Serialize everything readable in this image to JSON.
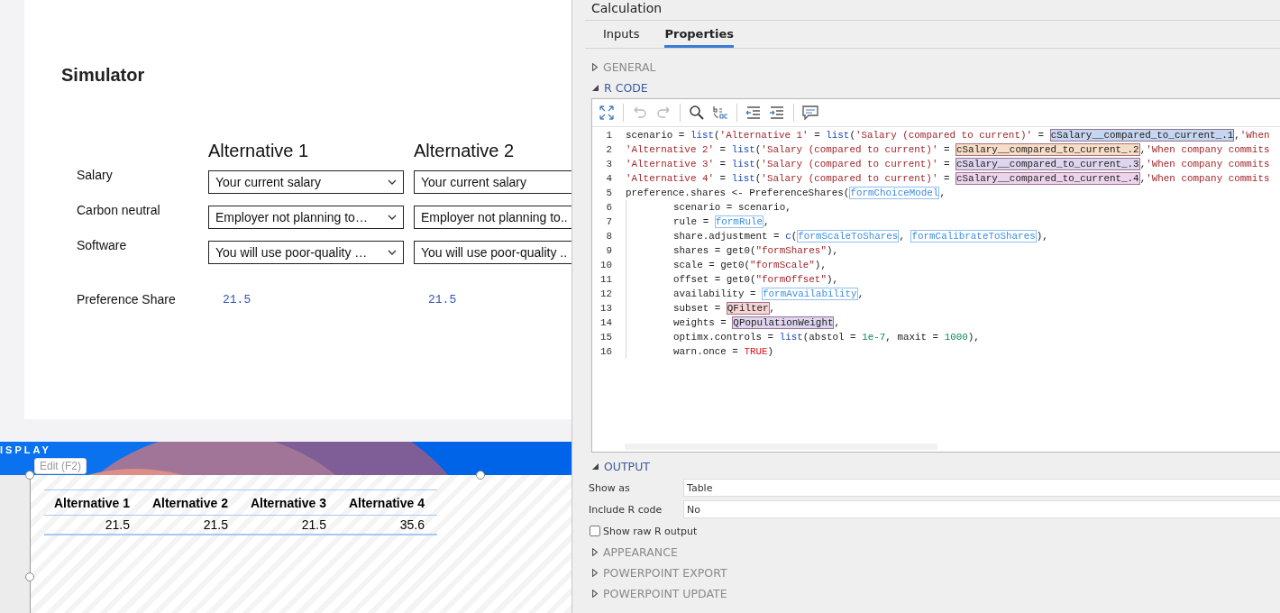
{
  "simulator": {
    "title": "Simulator",
    "alternatives": [
      {
        "name": "Alternative 1",
        "clipped": false,
        "share": "21.5"
      },
      {
        "name": "Alternative 2",
        "clipped": true,
        "share": "21.5"
      }
    ],
    "attributes": [
      {
        "label": "Salary",
        "values": [
          "Your current salary",
          "Your current salary"
        ]
      },
      {
        "label": "Carbon neutral",
        "values": [
          "Employer not planning to…",
          "Employer not planning to.."
        ]
      },
      {
        "label": "Software",
        "values": [
          "You will use poor-quality …",
          "You will use poor-quality .."
        ]
      }
    ],
    "share_label": "Preference Share"
  },
  "display": {
    "banner_text": "ISPLAY",
    "tooltip": "Edit (F2)",
    "table": {
      "columns": [
        "Alternative 1",
        "Alternative 2",
        "Alternative 3",
        "Alternative 4"
      ],
      "rows": [
        [
          "21.5",
          "21.5",
          "21.5",
          "35.6"
        ]
      ]
    }
  },
  "calculation": {
    "title": "Calculation",
    "tabs": [
      {
        "label": "Inputs",
        "selected": false
      },
      {
        "label": "Properties",
        "selected": true
      }
    ],
    "sections_before": [
      {
        "label": "GENERAL",
        "expanded": false
      },
      {
        "label": "R CODE",
        "expanded": true
      }
    ],
    "code": [
      {
        "number": "1",
        "indented": false,
        "segments": [
          {
            "text": "scenario = ",
            "kind": "plain"
          },
          {
            "text": "list",
            "kind": "func"
          },
          {
            "text": "(",
            "kind": "plain"
          },
          {
            "text": "'Alternative 1'",
            "kind": "str"
          },
          {
            "text": " = ",
            "kind": "plain"
          },
          {
            "text": "list",
            "kind": "func"
          },
          {
            "text": "(",
            "kind": "plain"
          },
          {
            "text": "'Salary (compared to current)'",
            "kind": "str"
          },
          {
            "text": " = ",
            "kind": "plain"
          },
          {
            "text": "cSalary__compared_to_current_.1",
            "kind": "var",
            "color": "#c6d6f0"
          },
          {
            "text": ",",
            "kind": "plain"
          },
          {
            "text": "'When",
            "kind": "str"
          }
        ]
      },
      {
        "number": "2",
        "indented": false,
        "segments": [
          {
            "text": "'Alternative 2'",
            "kind": "str"
          },
          {
            "text": " = ",
            "kind": "plain"
          },
          {
            "text": "list",
            "kind": "func"
          },
          {
            "text": "(",
            "kind": "plain"
          },
          {
            "text": "'Salary (compared to current)'",
            "kind": "str"
          },
          {
            "text": " = ",
            "kind": "plain"
          },
          {
            "text": "cSalary__compared_to_current_.2",
            "kind": "var",
            "color": "#f7dcc6"
          },
          {
            "text": ",",
            "kind": "plain"
          },
          {
            "text": "'When company commits",
            "kind": "str"
          }
        ]
      },
      {
        "number": "3",
        "indented": false,
        "segments": [
          {
            "text": "'Alternative 3'",
            "kind": "str"
          },
          {
            "text": " = ",
            "kind": "plain"
          },
          {
            "text": "list",
            "kind": "func"
          },
          {
            "text": "(",
            "kind": "plain"
          },
          {
            "text": "'Salary (compared to current)'",
            "kind": "str"
          },
          {
            "text": " = ",
            "kind": "plain"
          },
          {
            "text": "cSalary__compared_to_current_.3",
            "kind": "var",
            "color": "#ded6ef"
          },
          {
            "text": ",",
            "kind": "plain"
          },
          {
            "text": "'When company commits",
            "kind": "str"
          }
        ]
      },
      {
        "number": "4",
        "indented": false,
        "segments": [
          {
            "text": "'Alternative 4'",
            "kind": "str"
          },
          {
            "text": " = ",
            "kind": "plain"
          },
          {
            "text": "list",
            "kind": "func"
          },
          {
            "text": "(",
            "kind": "plain"
          },
          {
            "text": "'Salary (compared to current)'",
            "kind": "str"
          },
          {
            "text": " = ",
            "kind": "plain"
          },
          {
            "text": "cSalary__compared_to_current_.4",
            "kind": "var",
            "color": "#ecd4ec"
          },
          {
            "text": ",",
            "kind": "plain"
          },
          {
            "text": "'When company commits",
            "kind": "str"
          }
        ]
      },
      {
        "number": "5",
        "indented": false,
        "segments": [
          {
            "text": "preference.shares <- PreferenceShares(",
            "kind": "plain"
          },
          {
            "text": "formChoiceModel",
            "kind": "ref"
          },
          {
            "text": ",",
            "kind": "plain"
          }
        ]
      },
      {
        "number": "6",
        "indented": true,
        "segments": [
          {
            "text": "scenario = scenario,",
            "kind": "plain"
          }
        ]
      },
      {
        "number": "7",
        "indented": true,
        "segments": [
          {
            "text": "rule = ",
            "kind": "plain"
          },
          {
            "text": "formRule",
            "kind": "ref"
          },
          {
            "text": ",",
            "kind": "plain"
          }
        ]
      },
      {
        "number": "8",
        "indented": true,
        "segments": [
          {
            "text": "share.adjustment = ",
            "kind": "plain"
          },
          {
            "text": "c",
            "kind": "func"
          },
          {
            "text": "(",
            "kind": "plain"
          },
          {
            "text": "formScaleToShares",
            "kind": "ref"
          },
          {
            "text": ", ",
            "kind": "plain"
          },
          {
            "text": "formCalibrateToShares",
            "kind": "ref"
          },
          {
            "text": "),",
            "kind": "plain"
          }
        ]
      },
      {
        "number": "9",
        "indented": true,
        "segments": [
          {
            "text": "shares = get0(",
            "kind": "plain"
          },
          {
            "text": "\"formShares\"",
            "kind": "str"
          },
          {
            "text": "),",
            "kind": "plain"
          }
        ]
      },
      {
        "number": "10",
        "indented": true,
        "segments": [
          {
            "text": "scale = get0(",
            "kind": "plain"
          },
          {
            "text": "\"formScale\"",
            "kind": "str"
          },
          {
            "text": "),",
            "kind": "plain"
          }
        ]
      },
      {
        "number": "11",
        "indented": true,
        "segments": [
          {
            "text": "offset = get0(",
            "kind": "plain"
          },
          {
            "text": "\"formOffset\"",
            "kind": "str"
          },
          {
            "text": "),",
            "kind": "plain"
          }
        ]
      },
      {
        "number": "12",
        "indented": true,
        "segments": [
          {
            "text": "availability = ",
            "kind": "plain"
          },
          {
            "text": "formAvailability",
            "kind": "ref"
          },
          {
            "text": ",",
            "kind": "plain"
          }
        ]
      },
      {
        "number": "13",
        "indented": true,
        "segments": [
          {
            "text": "subset = ",
            "kind": "plain"
          },
          {
            "text": "QFilter",
            "kind": "var",
            "color": "#f6d4d4"
          },
          {
            "text": ",",
            "kind": "plain"
          }
        ]
      },
      {
        "number": "14",
        "indented": true,
        "segments": [
          {
            "text": "weights = ",
            "kind": "plain"
          },
          {
            "text": "QPopulationWeight",
            "kind": "var",
            "color": "#ded6ef"
          },
          {
            "text": ",",
            "kind": "plain"
          }
        ]
      },
      {
        "number": "15",
        "indented": true,
        "segments": [
          {
            "text": "optimx.controls = ",
            "kind": "plain"
          },
          {
            "text": "list",
            "kind": "func"
          },
          {
            "text": "(abstol = ",
            "kind": "plain"
          },
          {
            "text": "1e-7",
            "kind": "num"
          },
          {
            "text": ", maxit = ",
            "kind": "plain"
          },
          {
            "text": "1000",
            "kind": "num"
          },
          {
            "text": "),",
            "kind": "plain"
          }
        ]
      },
      {
        "number": "16",
        "indented": true,
        "segments": [
          {
            "text": "warn.once = ",
            "kind": "plain"
          },
          {
            "text": "TRUE",
            "kind": "const"
          },
          {
            "text": ")",
            "kind": "plain"
          }
        ]
      }
    ],
    "output": {
      "label": "OUTPUT",
      "expanded": true,
      "fields": [
        {
          "label": "Show as",
          "value": "Table"
        },
        {
          "label": "Include R code",
          "value": "No"
        }
      ],
      "checkbox": {
        "label": "Show raw R output",
        "checked": false
      }
    },
    "sections_after": [
      {
        "label": "APPEARANCE",
        "expanded": false
      },
      {
        "label": "POWERPOINT EXPORT",
        "expanded": false
      },
      {
        "label": "POWERPOINT UPDATE",
        "expanded": false
      }
    ]
  }
}
